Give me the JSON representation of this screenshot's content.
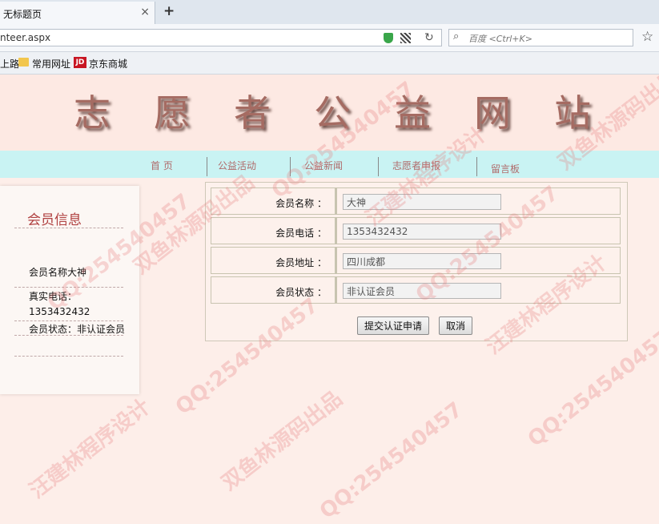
{
  "browser": {
    "tab_title": "无标题页",
    "close_glyph": "×",
    "new_tab_glyph": "+",
    "url": "nteer.aspx",
    "search_placeholder": "百度 <Ctrl+K>",
    "bookmarks": [
      "上路",
      "常用网址",
      "京东商城"
    ],
    "jd_badge": "JD"
  },
  "site": {
    "banner_chars": [
      "志",
      "愿",
      "者",
      "公",
      "益",
      "网",
      "站"
    ],
    "menu": [
      "首 页",
      "公益活动",
      "公益新闻",
      "志愿者申报",
      "留言板"
    ]
  },
  "sidebar": {
    "title": "会员信息",
    "name_line": "会员名称大神",
    "phone_line": "真实电话：1353432432",
    "status_line": "会员状态：非认证会员"
  },
  "form": {
    "rows": [
      {
        "label": "会员名称 ：",
        "value": "大神"
      },
      {
        "label": "会员电话 ：",
        "value": "1353432432"
      },
      {
        "label": "会员地址 ：",
        "value": "四川成都"
      },
      {
        "label": "会员状态 ：",
        "value": "非认证会员"
      }
    ],
    "submit_label": "提交认证申请",
    "cancel_label": "取消"
  },
  "watermarks": [
    "QQ:254540457",
    "双鱼林源码出品",
    "汪建林程序设计"
  ]
}
